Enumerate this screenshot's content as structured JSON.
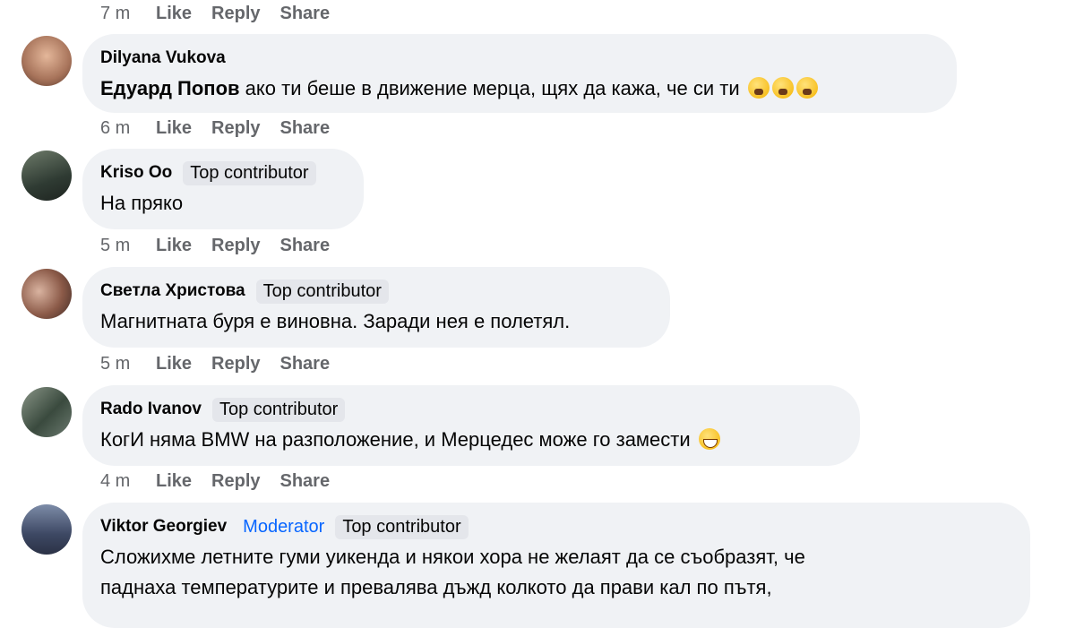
{
  "top_actions": {
    "time": "7 m",
    "like": "Like",
    "reply": "Reply",
    "share": "Share"
  },
  "comments": [
    {
      "author": "Dilyana Vukova",
      "mention": "Едуард Попов",
      "text": " ако ти беше в движение мерца, щях да кажа, че си ти",
      "emoji": [
        "astonished-face",
        "astonished-face",
        "astonished-face"
      ],
      "time": "6 m",
      "like": "Like",
      "reply": "Reply",
      "share": "Share"
    },
    {
      "author": "Kriso Oo",
      "badge": "Top contributor",
      "text": "На пряко",
      "time": "5 m",
      "like": "Like",
      "reply": "Reply",
      "share": "Share"
    },
    {
      "author": "Светла Христова",
      "badge": "Top contributor",
      "text": "Магнитната буря е виновна. Заради нея е полетял.",
      "time": "5 m",
      "like": "Like",
      "reply": "Reply",
      "share": "Share"
    },
    {
      "author": "Rado Ivanov",
      "badge": "Top contributor",
      "text": "КогИ няма BMW на разположение, и Мерцедес може го замести",
      "emoji": [
        "laughing-face"
      ],
      "time": "4 m",
      "like": "Like",
      "reply": "Reply",
      "share": "Share"
    },
    {
      "author": "Viktor Georgiev",
      "role": "Moderator",
      "badge": "Top contributor",
      "text_line1": "Сложихме летните гуми уикенда и някои хора не желаят да се съобразят, че",
      "text_line2": "паднаха температурите и превалява дъжд колкото да прави кал по пътя,"
    }
  ],
  "colors": {
    "bubble": "#f0f2f5",
    "muted": "#65676b",
    "moderator": "#0866ff",
    "badge": "#e4e6eb"
  }
}
